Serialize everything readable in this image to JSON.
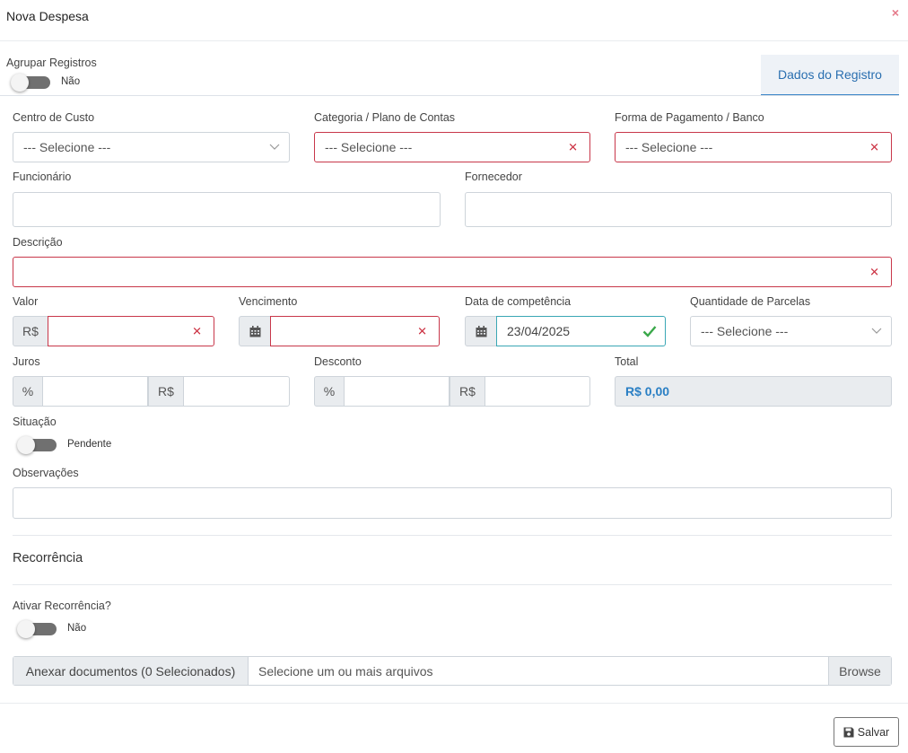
{
  "modal": {
    "title": "Nova Despesa",
    "close": "×"
  },
  "group": {
    "label": "Agrupar Registros",
    "toggle_text": "Não"
  },
  "tab": {
    "label": "Dados do Registro"
  },
  "fields": {
    "centro_custo": {
      "label": "Centro de Custo",
      "placeholder": "--- Selecione ---"
    },
    "categoria": {
      "label": "Categoria / Plano de Contas",
      "placeholder": "--- Selecione ---"
    },
    "forma_pagamento": {
      "label": "Forma de Pagamento / Banco",
      "placeholder": "--- Selecione ---"
    },
    "funcionario": {
      "label": "Funcionário"
    },
    "fornecedor": {
      "label": "Fornecedor"
    },
    "descricao": {
      "label": "Descrição"
    },
    "valor": {
      "label": "Valor",
      "prefix": "R$"
    },
    "vencimento": {
      "label": "Vencimento"
    },
    "competencia": {
      "label": "Data de competência",
      "value": "23/04/2025"
    },
    "parcelas": {
      "label": "Quantidade de Parcelas",
      "placeholder": "--- Selecione ---"
    },
    "juros": {
      "label": "Juros",
      "percent": "%",
      "currency": "R$"
    },
    "desconto": {
      "label": "Desconto",
      "percent": "%",
      "currency": "R$"
    },
    "total": {
      "label": "Total",
      "value": "R$ 0,00"
    },
    "situacao": {
      "label": "Situação",
      "toggle_text": "Pendente"
    },
    "observacoes": {
      "label": "Observações"
    }
  },
  "recorrencia": {
    "title": "Recorrência",
    "ativar_label": "Ativar Recorrência?",
    "toggle_text": "Não"
  },
  "attachments": {
    "label": "Anexar documentos (0 Selecionados)",
    "placeholder": "Selecione um ou mais arquivos",
    "browse": "Browse"
  },
  "footer": {
    "save_label": "Salvar"
  },
  "colors": {
    "invalid": "#c8374a",
    "valid": "#3aa7b5",
    "accent": "#2a6fb0"
  }
}
